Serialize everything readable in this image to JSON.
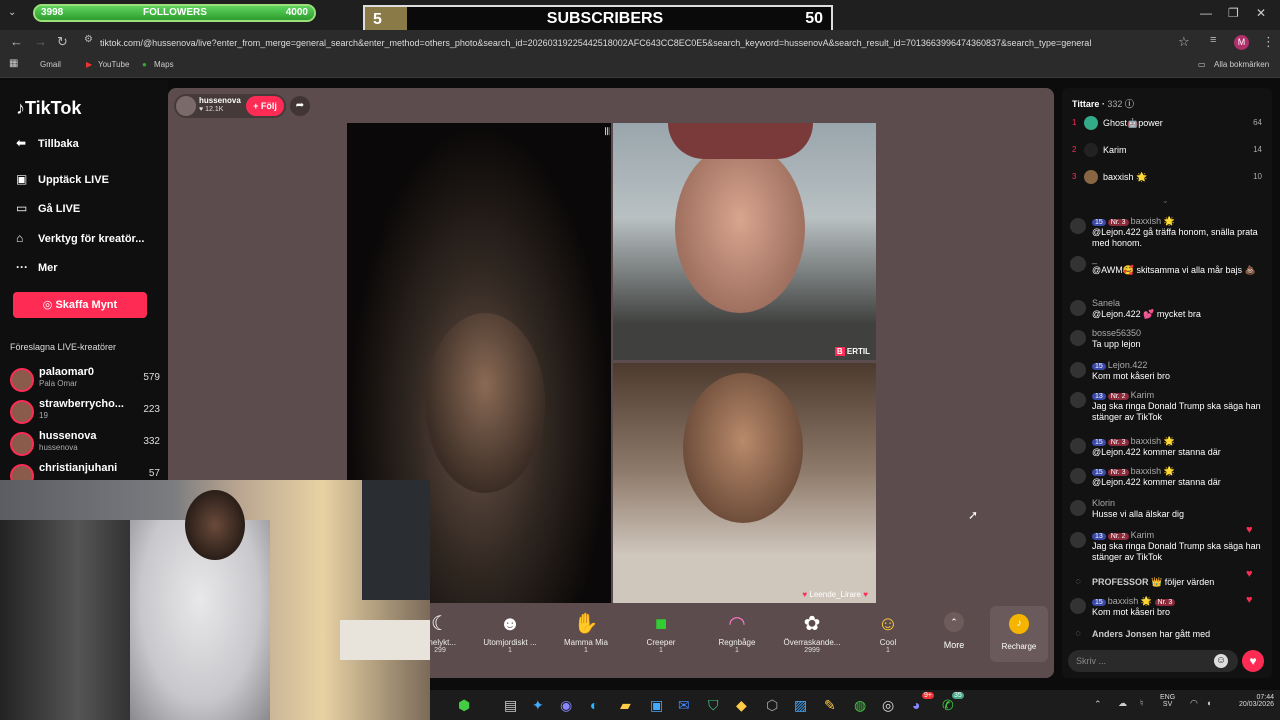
{
  "overlay": {
    "followers_label": "FOLLOWERS",
    "followers_current": "3998",
    "followers_goal": "4000",
    "followers_progress": 0.999,
    "subs_count": "5",
    "subs_label": "SUBSCRIBERS",
    "subs_goal": "50"
  },
  "browser": {
    "url": "tiktok.com/@hussenova/live?enter_from_merge=general_search&enter_method=others_photo&search_id=20260319225442518002AFC643CC8EC0E5&search_keyword=hussenovA&search_result_id=7013663996474360837&search_type=general",
    "bookmarks": [
      "Gmail",
      "YouTube",
      "Maps"
    ],
    "all_bookmarks": "Alla bokmärken",
    "profile_initial": "M"
  },
  "sidebar": {
    "logo": "TikTok",
    "back": "Tillbaka",
    "items": [
      {
        "label": "Upptäck LIVE",
        "icon": "calendar-icon"
      },
      {
        "label": "Gå LIVE",
        "icon": "video-icon"
      },
      {
        "label": "Verktyg för kreatör...",
        "icon": "house-icon"
      },
      {
        "label": "Mer",
        "icon": "more-icon"
      }
    ],
    "coin_button": "Skaffa Mynt",
    "suggested_title": "Föreslagna LIVE-kreatörer",
    "creators": [
      {
        "name": "palaomar0",
        "sub": "Pala Omar",
        "count": "579"
      },
      {
        "name": "strawberrycho...",
        "sub": "19",
        "count": "223"
      },
      {
        "name": "hussenova",
        "sub": "hussenova",
        "count": "332"
      },
      {
        "name": "christianjuhani",
        "sub": "",
        "count": "57"
      }
    ]
  },
  "stream": {
    "host_name": "hussenova",
    "host_likes": "12.1K",
    "follow_button": "+ Följ",
    "panel2_tag": "ERTIL",
    "panel3_tag": "Leende_Lirare"
  },
  "gifts": [
    {
      "label": "ånelykt...",
      "price": "299",
      "glyph": "☾"
    },
    {
      "label": "Utomjordiskt ...",
      "price": "1",
      "glyph": "☻"
    },
    {
      "label": "Mamma Mia",
      "price": "1",
      "glyph": "✋"
    },
    {
      "label": "Creeper",
      "price": "1",
      "glyph": "■"
    },
    {
      "label": "Regnbåge",
      "price": "1",
      "glyph": "◠"
    },
    {
      "label": "Överraskande...",
      "price": "2999",
      "glyph": "✿"
    },
    {
      "label": "Cool",
      "price": "1",
      "glyph": "☺"
    }
  ],
  "gift_more": "More",
  "recharge": "Recharge",
  "chat": {
    "viewers_label": "Tittare",
    "viewers_count": "332",
    "top": [
      {
        "rank": "1",
        "name": "Ghost🤖power",
        "score": "64"
      },
      {
        "rank": "2",
        "name": "Karim",
        "score": "14"
      },
      {
        "rank": "3",
        "name": "baxxish 🌟",
        "score": "10"
      }
    ],
    "messages": [
      {
        "user": "baxxish 🌟",
        "text": "@Lejon.422 gå träffa honom, snälla prata med honom.",
        "lvl": "15",
        "nr": "Nr. 3"
      },
      {
        "user": "_",
        "text": "@AWM🥰 skitsamma vi alla mår bajs 💩",
        "lvl": "",
        "nr": ""
      },
      {
        "user": "Sanela",
        "text": "@Lejon.422 💕 mycket bra",
        "lvl": "",
        "nr": ""
      },
      {
        "user": "bosse56350",
        "text": "Ta upp lejon",
        "lvl": "",
        "nr": ""
      },
      {
        "user": "Lejon.422",
        "text": "Kom mot kåseri bro",
        "lvl": "15",
        "nr": ""
      },
      {
        "user": "Karim",
        "text": "Jag ska ringa Donald Trump ska säga han stänger av TikTok",
        "lvl": "13",
        "nr": "Nr. 2"
      },
      {
        "user": "baxxish 🌟",
        "text": "@Lejon.422 kommer stanna där",
        "lvl": "15",
        "nr": "Nr. 3"
      },
      {
        "user": "baxxish 🌟",
        "text": "@Lejon.422 kommer stanna där",
        "lvl": "15",
        "nr": "Nr. 3"
      },
      {
        "user": "Klorin",
        "text": "Husse vi alla älskar dig",
        "lvl": "",
        "nr": ""
      },
      {
        "user": "Karim",
        "text": "Jag ska ringa Donald Trump ska säga han stänger av TikTok",
        "lvl": "13",
        "nr": "Nr. 2"
      }
    ],
    "events": [
      {
        "user": "PROFESSOR 👑",
        "text": "följer värden"
      },
      {
        "user": "baxxish 🌟",
        "text": "Kom mot kåseri bro",
        "lvl": "15",
        "nr": "Nr. 3"
      },
      {
        "user": "Anders Jonsen",
        "text": "har gått med"
      }
    ],
    "input_placeholder": "Skriv ..."
  },
  "taskbar": {
    "lang": "ENG",
    "lang_sub": "SV",
    "time": "07:44",
    "date": "20/03/2026",
    "badge1": "9+",
    "badge2": "35"
  }
}
